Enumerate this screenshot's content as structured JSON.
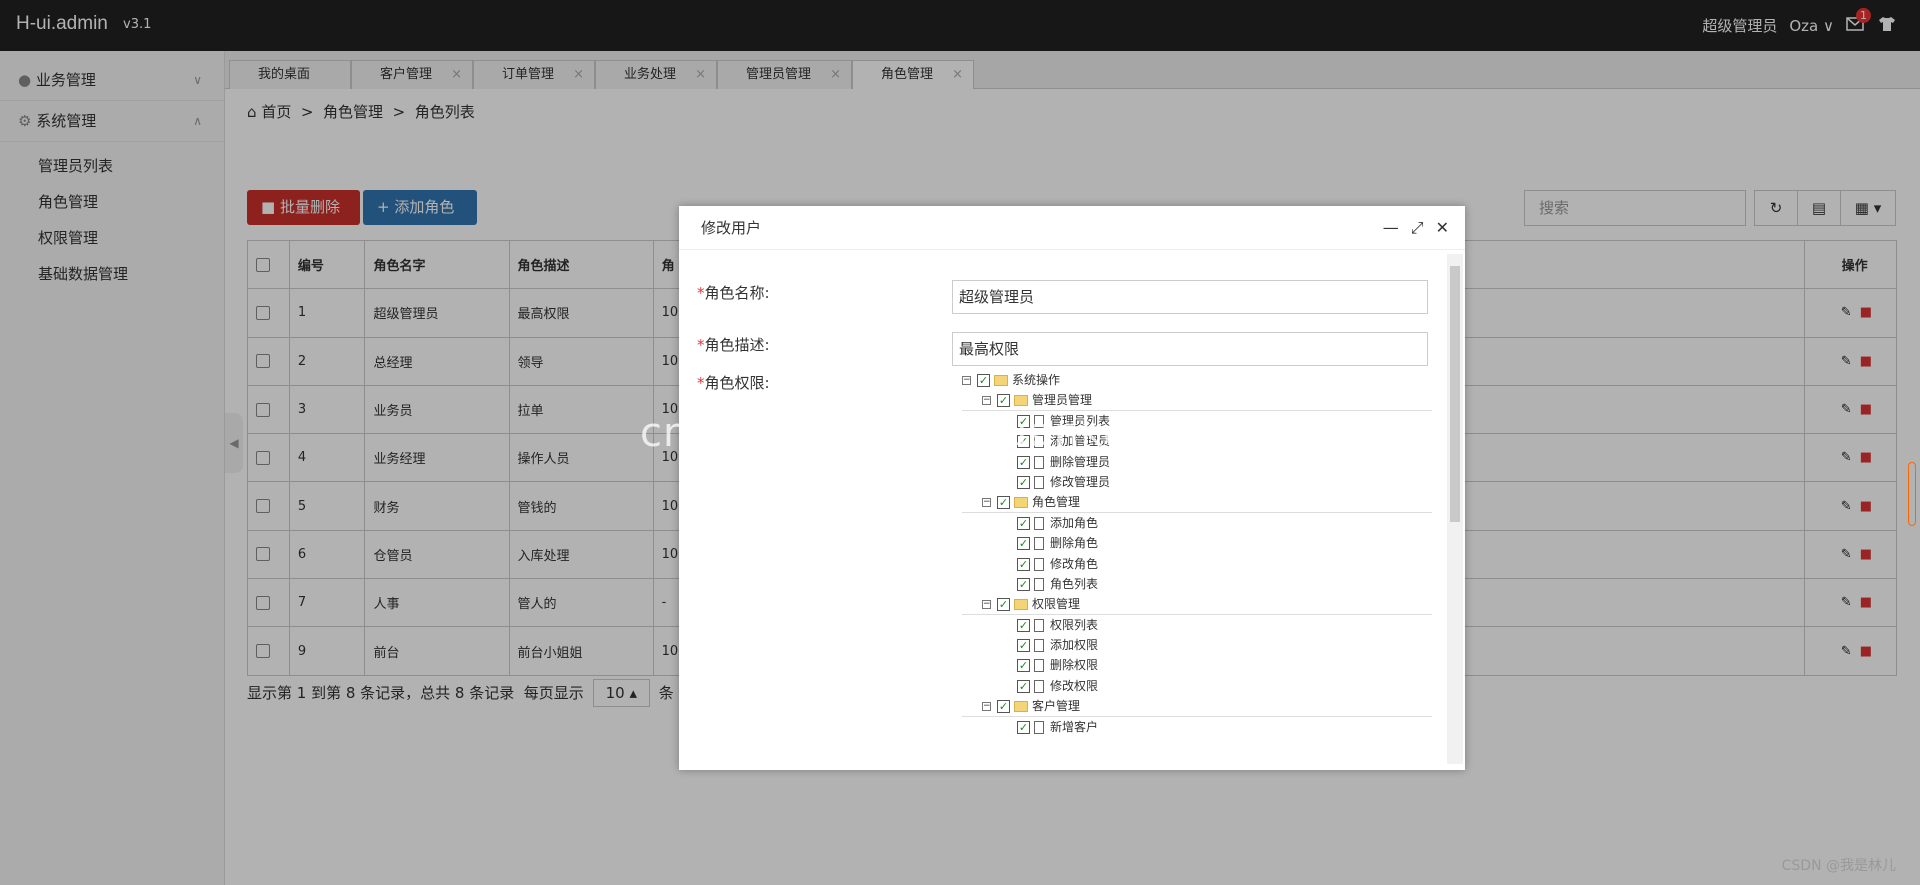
{
  "app": {
    "name": "H-ui.admin",
    "version": "v3.1"
  },
  "top_right": {
    "role": "超级管理员",
    "user": "Oza",
    "mail_badge": "1"
  },
  "sidebar": {
    "groups": [
      {
        "label": "业务管理"
      },
      {
        "label": "系统管理"
      }
    ],
    "items": [
      {
        "label": "管理员列表"
      },
      {
        "label": "角色管理"
      },
      {
        "label": "权限管理"
      },
      {
        "label": "基础数据管理"
      }
    ]
  },
  "tabs": [
    {
      "label": "我的桌面"
    },
    {
      "label": "客户管理"
    },
    {
      "label": "订单管理"
    },
    {
      "label": "业务处理"
    },
    {
      "label": "管理员管理"
    },
    {
      "label": "角色管理"
    }
  ],
  "breadcrumb": {
    "home": "首页",
    "sep": ">",
    "level1": "角色管理",
    "level2": "角色列表"
  },
  "toolbar": {
    "batch_delete": "批量删除",
    "add_role": "添加角色",
    "search_placeholder": "搜索"
  },
  "table": {
    "headers": [
      "编号",
      "角色名字",
      "角色描述",
      "角",
      "操作"
    ],
    "rows": [
      [
        "1",
        "超级管理员",
        "最高权限",
        "10"
      ],
      [
        "2",
        "总经理",
        "领导",
        "10"
      ],
      [
        "3",
        "业务员",
        "拉单",
        "10"
      ],
      [
        "4",
        "业务经理",
        "操作人员",
        "10"
      ],
      [
        "5",
        "财务",
        "管钱的",
        "10"
      ],
      [
        "6",
        "仓管员",
        "入库处理",
        "10"
      ],
      [
        "7",
        "人事",
        "管人的",
        "-"
      ],
      [
        "9",
        "前台",
        "前台小姐姐",
        "10"
      ]
    ]
  },
  "pager": {
    "summary": "显示第 1 到第 8 条记录，总共 8 条记录",
    "per_page_label": "每页显示",
    "per_page": "10",
    "suffix": "条"
  },
  "modal": {
    "title": "修改用户",
    "name_label": "角色名称:",
    "name_value": "超级管理员",
    "desc_label": "角色描述:",
    "desc_value": "最高权限",
    "perm_label": "角色权限:",
    "tree": [
      {
        "label": "系统操作",
        "level": 0,
        "type": "folder"
      },
      {
        "label": "管理员管理",
        "level": 1,
        "type": "folder"
      },
      {
        "label": "管理员列表",
        "level": 2,
        "type": "file"
      },
      {
        "label": "添加管理员",
        "level": 2,
        "type": "file"
      },
      {
        "label": "删除管理员",
        "level": 2,
        "type": "file"
      },
      {
        "label": "修改管理员",
        "level": 2,
        "type": "file"
      },
      {
        "label": "角色管理",
        "level": 1,
        "type": "folder"
      },
      {
        "label": "添加角色",
        "level": 2,
        "type": "file"
      },
      {
        "label": "删除角色",
        "level": 2,
        "type": "file"
      },
      {
        "label": "修改角色",
        "level": 2,
        "type": "file"
      },
      {
        "label": "角色列表",
        "level": 2,
        "type": "file"
      },
      {
        "label": "权限管理",
        "level": 1,
        "type": "folder"
      },
      {
        "label": "权限列表",
        "level": 2,
        "type": "file"
      },
      {
        "label": "添加权限",
        "level": 2,
        "type": "file"
      },
      {
        "label": "删除权限",
        "level": 2,
        "type": "file"
      },
      {
        "label": "修改权限",
        "level": 2,
        "type": "file"
      },
      {
        "label": "客户管理",
        "level": 1,
        "type": "folder"
      },
      {
        "label": "新增客户",
        "level": 2,
        "type": "file"
      }
    ]
  },
  "watermark": "cn国观客www.uequanke.cn",
  "credit": "CSDN @我是林儿"
}
